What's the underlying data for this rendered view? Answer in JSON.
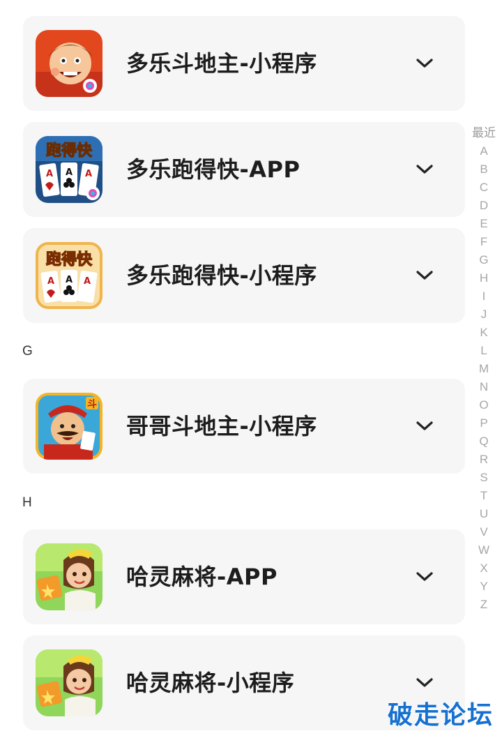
{
  "items": [
    {
      "title": "多乐斗地主-小程序",
      "icon": "doudizhu-icon"
    },
    {
      "title": "多乐跑得快-APP",
      "icon": "paodekuai-app-icon"
    },
    {
      "title": "多乐跑得快-小程序",
      "icon": "paodekuai-mini-icon"
    },
    {
      "title": "哥哥斗地主-小程序",
      "icon": "gege-doudizhu-icon"
    },
    {
      "title": "哈灵麻将-APP",
      "icon": "haling-mahjong-app-icon"
    },
    {
      "title": "哈灵麻将-小程序",
      "icon": "haling-mahjong-mini-icon"
    }
  ],
  "sections": {
    "g": "G",
    "h": "H"
  },
  "icon_labels": {
    "paodekuai": "跑得快",
    "dou": "斗",
    "ace": "A"
  },
  "index": {
    "recent": "最近",
    "letters": [
      "A",
      "B",
      "C",
      "D",
      "E",
      "F",
      "G",
      "H",
      "I",
      "J",
      "K",
      "L",
      "M",
      "N",
      "O",
      "P",
      "Q",
      "R",
      "S",
      "T",
      "U",
      "V",
      "W",
      "X",
      "Y",
      "Z"
    ]
  },
  "watermark": "破走论坛",
  "colors": {
    "card": "#f6f6f6",
    "accent": "#1570d0"
  }
}
